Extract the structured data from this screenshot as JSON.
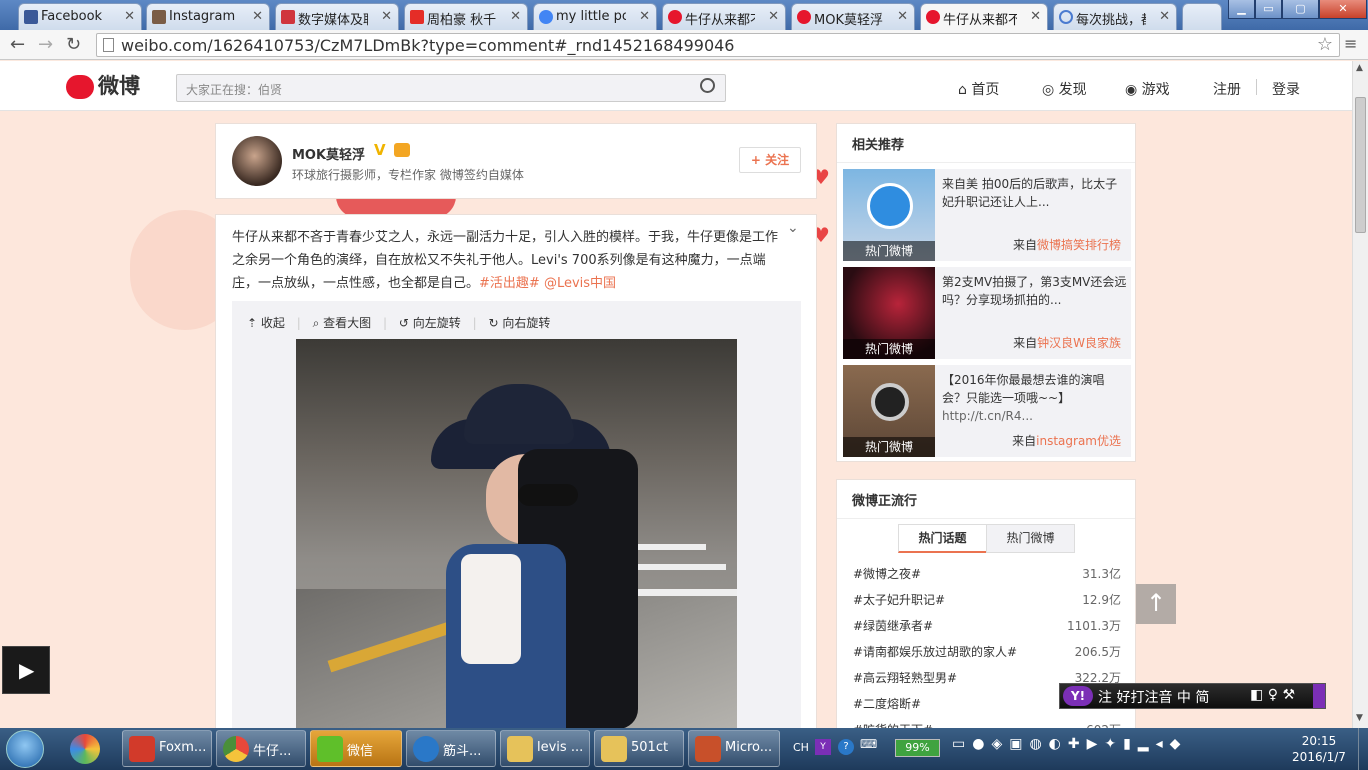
{
  "browser": {
    "tabs": [
      {
        "label": "Facebook",
        "icon": "facebook-icon",
        "color": "#3b5998"
      },
      {
        "label": "Instagram",
        "icon": "instagram-icon",
        "color": "#7a5c45"
      },
      {
        "label": "数字媒体及职业",
        "icon": "d-icon",
        "color": "#d0353d"
      },
      {
        "label": "周柏豪 秋千 -",
        "icon": "youtube-icon",
        "color": "#e52d27"
      },
      {
        "label": "my little pony",
        "icon": "google-icon",
        "color": "#4285f4"
      },
      {
        "label": "牛仔从来都不会",
        "icon": "weibo-icon",
        "color": "#e6162d"
      },
      {
        "label": "MOK莫轻浮的",
        "icon": "weibo-icon",
        "color": "#e6162d"
      },
      {
        "label": "牛仔从来都不会",
        "icon": "weibo-icon",
        "color": "#e6162d"
      },
      {
        "label": "每次挑战，都是",
        "icon": "loading-icon",
        "color": "#4a7bd0"
      }
    ],
    "url": "weibo.com/1626410753/CzM7LDmBk?type=comment#_rnd1452168499046"
  },
  "weibo": {
    "logo": "微博",
    "search_placeholder": "大家正在搜：伯贤",
    "nav": [
      "首页",
      "发现",
      "游戏",
      "注册",
      "登录"
    ],
    "author": {
      "name": "MOK莫轻浮",
      "desc": "环球旅行摄影师，专栏作家 微博签约自媒体",
      "follow": "+ 关注"
    },
    "post": {
      "text": "牛仔从来都不吝于青春少艾之人，永远一副活力十足，引人入胜的模样。于我，牛仔更像是工作之余另一个角色的演绎，自在放松又不失礼于他人。Levi's 700系列像是有这种魔力，一点端庄，一点放纵，一点性感，也全都是自己。",
      "tag1": "#活出趣#",
      "tag2": "@Levis中国",
      "tools": [
        "收起",
        "查看大图",
        "向左旋转",
        "向右旋转"
      ]
    },
    "related": {
      "title": "相关推荐",
      "items": [
        {
          "text": "来自美 拍00后的后歌声，比太子妃升职记还让人上...",
          "label": "热门微博",
          "src_prefix": "来自",
          "src": "微博搞笑排行榜"
        },
        {
          "text": "第2支MV拍摄了，第3支MV还会远吗？分享现场抓拍的...",
          "label": "热门微博",
          "src_prefix": "来自",
          "src": "钟汉良W良家族"
        },
        {
          "text": "【2016年你最最想去谁的演唱会？只能选一项哦~~】",
          "link": "http://t.cn/R4...",
          "label": "热门微博",
          "src_prefix": "来自",
          "src": "instagram优选"
        }
      ]
    },
    "trending": {
      "title": "微博正流行",
      "tabs": [
        "热门话题",
        "热门微博"
      ],
      "rows": [
        {
          "topic": "#微博之夜#",
          "count": "31.3亿"
        },
        {
          "topic": "#太子妃升职记#",
          "count": "12.9亿"
        },
        {
          "topic": "#绿茵继承者#",
          "count": "1101.3万"
        },
        {
          "topic": "#请南都娱乐放过胡歌的家人#",
          "count": "206.5万"
        },
        {
          "topic": "#高云翔轻熟型男#",
          "count": "322.2万"
        },
        {
          "topic": "#二度熔断#",
          "count": ""
        },
        {
          "topic": "#旷货的天下#",
          "count": "602万"
        }
      ]
    }
  },
  "ime": {
    "text": "注 好打注音 中 简"
  },
  "taskbar": {
    "apps": [
      {
        "label": "Foxm...",
        "icon": "foxmail-icon",
        "color": "#d23a2a"
      },
      {
        "label": "牛仔...",
        "icon": "chrome-icon",
        "color": "#4a8f3a"
      },
      {
        "label": "微信",
        "icon": "wechat-icon",
        "color": "#5fbf2a"
      },
      {
        "label": "筋斗...",
        "icon": "jindou-icon",
        "color": "#2a78c8"
      },
      {
        "label": "levis ...",
        "icon": "folder-icon",
        "color": "#e6c25a"
      },
      {
        "label": "501ct",
        "icon": "folder-icon",
        "color": "#e6c25a"
      },
      {
        "label": "Micro...",
        "icon": "powerpoint-icon",
        "color": "#c8502a"
      }
    ],
    "lang": "CH",
    "battery": "99%",
    "time": "20:15",
    "date": "2016/1/7"
  }
}
